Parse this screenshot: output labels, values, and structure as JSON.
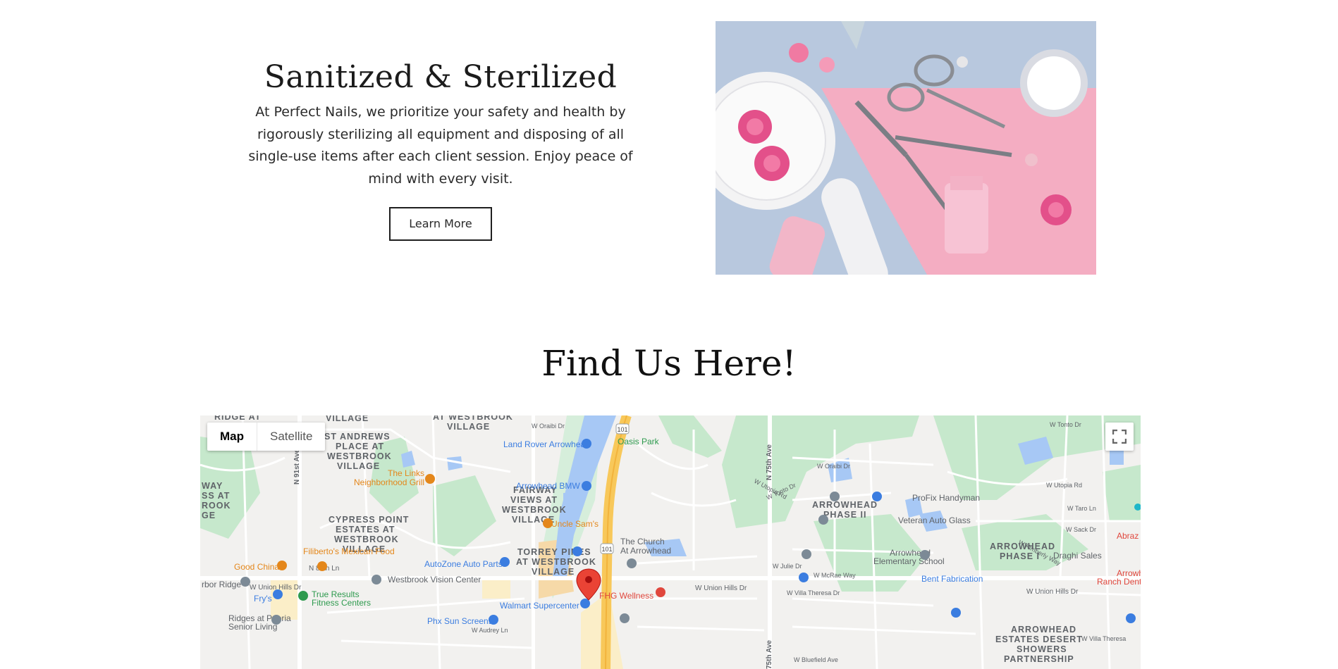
{
  "info": {
    "title": "Sanitized & Sterilized",
    "body": "At Perfect Nails, we prioritize your safety and health by rigorously sterilizing all equipment and disposing of all single-use items after each client session. Enjoy peace of mind with every visit.",
    "button": "Learn More"
  },
  "find": {
    "title": "Find Us Here!"
  },
  "map": {
    "tabs": [
      "Map",
      "Satellite"
    ],
    "places": {
      "land_rover": "Land Rover Arrowhead",
      "oasis_park": "Oasis Park",
      "links_1": "The Links",
      "links_2": "Neighborhood Grill",
      "bmw": "Arrowhead BMW",
      "uncle_sams": "Uncle Sam's",
      "church_1": "The Church",
      "church_2": "At Arrowhead",
      "filibertos": "Filiberto's Mexican Food",
      "good_china": "Good China",
      "autozone": "AutoZone Auto Parts",
      "westbrook_vision": "Westbrook Vision Center",
      "true_results_1": "True Results",
      "true_results_2": "Fitness Centers",
      "frys": "Fry's",
      "walmart": "Walmart Supercenter",
      "fhg": "FHG Wellness",
      "phx_sun": "Phx Sun Screens",
      "profix": "ProFix Handyman",
      "veteran": "Veteran Auto Glass",
      "arrowhead_school_1": "Arrowhead",
      "arrowhead_school_2": "Elementary School",
      "draghi": "Draghi Sales",
      "bent": "Bent Fabrication",
      "abraz": "Abraz",
      "arrowhead_ranch_1": "Arrowh",
      "arrowhead_ranch_2": "Ranch Dent",
      "ridges_1": "Ridges at Peoria",
      "ridges_2": "Senior Living",
      "arbor": "rbor Ridge"
    },
    "areas": {
      "ridge_at": "RIDGE AT",
      "village_top": "VILLAGE",
      "at_westbrook_village_top": "AT WESTBROOK",
      "at_westbrook_village_top2": "VILLAGE",
      "st_andrews_1": "ST ANDREWS",
      "st_andrews_2": "PLACE AT",
      "st_andrews_3": "WESTBROOK",
      "st_andrews_4": "VILLAGE",
      "fairway_1": "FAIRWAY",
      "fairway_2": "VIEWS AT",
      "fairway_3": "WESTBROOK",
      "fairway_4": "VILLAGE",
      "cypress_1": "CYPRESS POINT",
      "cypress_2": "ESTATES AT",
      "cypress_3": "WESTBROOK",
      "cypress_4": "VILLAGE",
      "torrey_1": "TORREY PINES",
      "torrey_2": "AT WESTBROOK",
      "torrey_3": "VILLAGE",
      "arrowhead_phase2_1": "ARROWHEAD",
      "arrowhead_phase2_2": "PHASE II",
      "arrowhead_phase1_1": "ARROWHEAD",
      "arrowhead_phase1_2": "PHASE I",
      "desert_1": "ARROWHEAD",
      "desert_2": "ESTATES DESERT",
      "desert_3": "SHOWERS",
      "desert_4": "PARTNERSHIP",
      "left_1": "WAY",
      "left_2": "SS AT",
      "left_3": "ROOK",
      "left_4": "GE"
    },
    "streets": {
      "union_hills_w": "W Union Hills Dr",
      "union_hills_e": "W Union Hills Dr",
      "union_hills_far": "W Union Hills Dr",
      "n91": "N 91st Ave",
      "n75": "N 75th Ave",
      "n75b": "N 75th Ave",
      "n89ln": "N 89th Ln",
      "oraibi": "W Oraibi Dr",
      "oraibi2": "W Oraibi Dr",
      "utopia": "W Utopia Rd",
      "utopia2": "W Utopia Rd",
      "tonto": "W Tonto Dr",
      "tonto2": "W Tonto Dr",
      "julie": "W Julie Dr",
      "mcrae": "W McRae Way",
      "villa_theresa": "W Villa Theresa Dr",
      "villa_theresa2": "W Villa Theresa",
      "bluefield": "W Bluefield Ave",
      "audrey": "W Audrey Ln",
      "sack": "W Sack Dr",
      "taro": "W Taro Ln",
      "kimberly": "W Kimberly Way",
      "hwy101a": "101",
      "hwy101b": "101"
    },
    "colors": {
      "land": "#f2f1ef",
      "park": "#c6e8cc",
      "water": "#a7c8f5",
      "freeway": "#f8c85a",
      "road": "#ffffff",
      "poi_blue": "#3b7de0",
      "poi_orange": "#e4871b",
      "poi_gray": "#7c8a96",
      "poi_green": "#2e9a4e",
      "poi_red": "#e0473d",
      "pin_red": "#ea4335"
    }
  }
}
